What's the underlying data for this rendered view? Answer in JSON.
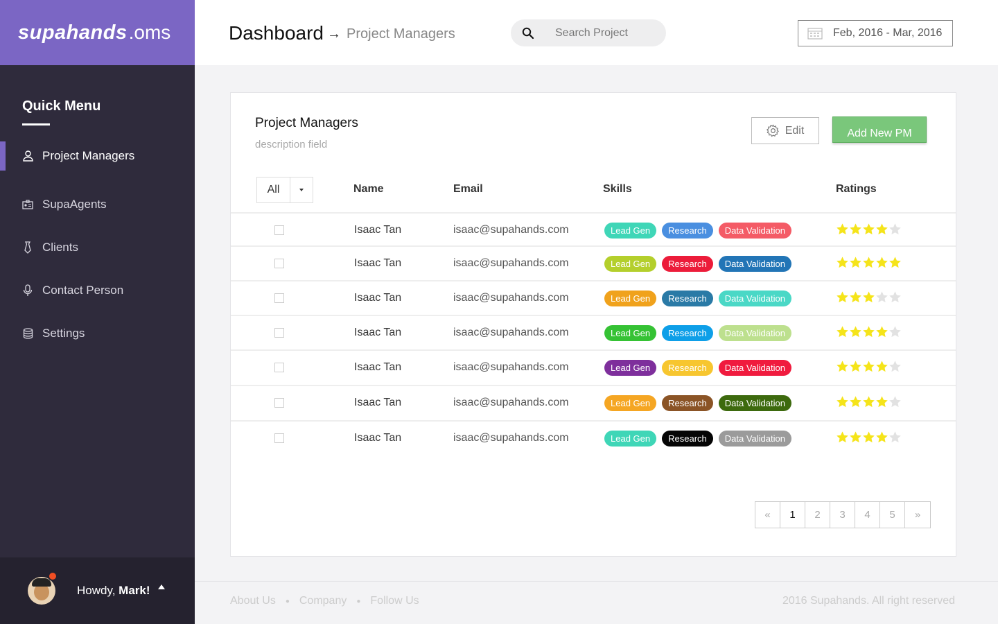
{
  "brand": {
    "name_bold": "supahands",
    "name_rest": ".oms"
  },
  "sidebar": {
    "heading": "Quick Menu",
    "items": [
      {
        "label": "Project Managers",
        "icon": "user-icon",
        "active": true
      },
      {
        "label": "SupaAgents",
        "icon": "id-card-icon",
        "active": false
      },
      {
        "label": "Clients",
        "icon": "tie-icon",
        "active": false
      },
      {
        "label": "Contact Person",
        "icon": "microphone-icon",
        "active": false
      },
      {
        "label": "Settings",
        "icon": "database-icon",
        "active": false
      }
    ],
    "user": {
      "greeting": "Howdy,",
      "name": "Mark!"
    }
  },
  "header": {
    "title": "Dashboard",
    "arrow": "→",
    "subtitle": "Project Managers",
    "search_placeholder": "Search Project",
    "date_range": "Feb, 2016 - Mar, 2016"
  },
  "card": {
    "title": "Project Managers",
    "description": "description field",
    "edit_label": "Edit",
    "add_label": "Add New PM",
    "filter_value": "All",
    "columns": [
      "Name",
      "Email",
      "Skills",
      "Ratings"
    ],
    "rows": [
      {
        "name": "Isaac Tan",
        "email": "isaac@supahands.com",
        "rating": 4,
        "skills": [
          {
            "label": "Lead Gen",
            "color": "#3fd6b7"
          },
          {
            "label": "Research",
            "color": "#4a8fe0"
          },
          {
            "label": "Data Validation",
            "color": "#f45b66"
          }
        ]
      },
      {
        "name": "Isaac Tan",
        "email": "isaac@supahands.com",
        "rating": 5,
        "skills": [
          {
            "label": "Lead Gen",
            "color": "#b4cf2c"
          },
          {
            "label": "Research",
            "color": "#ec1c3a"
          },
          {
            "label": "Data Validation",
            "color": "#2275b6"
          }
        ]
      },
      {
        "name": "Isaac Tan",
        "email": "isaac@supahands.com",
        "rating": 3,
        "skills": [
          {
            "label": "Lead Gen",
            "color": "#f0a21c"
          },
          {
            "label": "Research",
            "color": "#2a7aa6"
          },
          {
            "label": "Data Validation",
            "color": "#4ad8c6"
          }
        ]
      },
      {
        "name": "Isaac Tan",
        "email": "isaac@supahands.com",
        "rating": 4,
        "skills": [
          {
            "label": "Lead Gen",
            "color": "#35c234"
          },
          {
            "label": "Research",
            "color": "#0e9fe8"
          },
          {
            "label": "Data Validation",
            "color": "#bde08e"
          }
        ]
      },
      {
        "name": "Isaac Tan",
        "email": "isaac@supahands.com",
        "rating": 4,
        "skills": [
          {
            "label": "Lead Gen",
            "color": "#7e2f9c"
          },
          {
            "label": "Research",
            "color": "#f7c62f"
          },
          {
            "label": "Data Validation",
            "color": "#f01b3e"
          }
        ]
      },
      {
        "name": "Isaac Tan",
        "email": "isaac@supahands.com",
        "rating": 4,
        "skills": [
          {
            "label": "Lead Gen",
            "color": "#f5a623"
          },
          {
            "label": "Research",
            "color": "#8b5426"
          },
          {
            "label": "Data Validation",
            "color": "#3d6a0e"
          }
        ]
      },
      {
        "name": "Isaac Tan",
        "email": "isaac@supahands.com",
        "rating": 4,
        "skills": [
          {
            "label": "Lead Gen",
            "color": "#3fd6b7"
          },
          {
            "label": "Research",
            "color": "#050505"
          },
          {
            "label": "Data Validation",
            "color": "#9b9b9b"
          }
        ]
      }
    ],
    "pagination": [
      "«",
      "1",
      "2",
      "3",
      "4",
      "5",
      "»"
    ],
    "current_page": "1"
  },
  "footer": {
    "links": [
      "About Us",
      "Company",
      "Follow Us"
    ],
    "copyright": "2016 Supahands. All right reserved"
  },
  "colors": {
    "accent": "#7b66c4",
    "sidebar_bg": "#2f2b3c",
    "star_on": "#f5e41a",
    "star_off": "#e2e2e2",
    "add_button": "#7ac77b"
  }
}
